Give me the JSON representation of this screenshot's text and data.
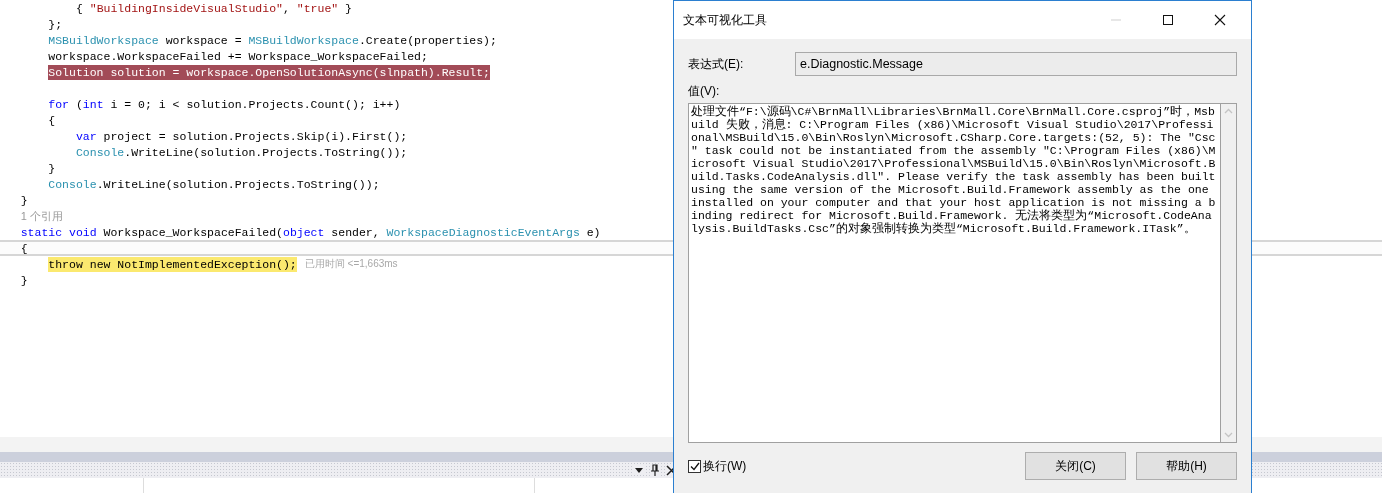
{
  "editor": {
    "lines": [
      {
        "kind": "code",
        "current": false,
        "error": false,
        "paused": false,
        "tokens": [
          {
            "kind": "plain",
            "text": "           { "
          },
          {
            "kind": "string",
            "text": "\"BuildingInsideVisualStudio\""
          },
          {
            "kind": "plain",
            "text": ", "
          },
          {
            "kind": "string",
            "text": "\"true\""
          },
          {
            "kind": "plain",
            "text": " }"
          }
        ]
      },
      {
        "kind": "code",
        "current": false,
        "error": false,
        "paused": false,
        "tokens": [
          {
            "kind": "plain",
            "text": "       };"
          }
        ]
      },
      {
        "kind": "code",
        "current": false,
        "error": false,
        "paused": false,
        "tokens": [
          {
            "kind": "type",
            "text": "       MSBuildWorkspace"
          },
          {
            "kind": "plain",
            "text": " workspace = "
          },
          {
            "kind": "type",
            "text": "MSBuildWorkspace"
          },
          {
            "kind": "plain",
            "text": ".Create(properties);"
          }
        ]
      },
      {
        "kind": "code",
        "current": false,
        "error": false,
        "paused": false,
        "tokens": [
          {
            "kind": "plain",
            "text": "       workspace.WorkspaceFailed += Workspace_WorkspaceFailed;"
          }
        ]
      },
      {
        "kind": "code",
        "current": false,
        "error": true,
        "paused": false,
        "tokens": [
          {
            "kind": "plain",
            "text": "       Solution solution = workspace.OpenSolutionAsync(slnpath).Result;"
          }
        ]
      },
      {
        "kind": "blank"
      },
      {
        "kind": "code",
        "current": false,
        "error": false,
        "paused": false,
        "tokens": [
          {
            "kind": "keyword",
            "text": "       for"
          },
          {
            "kind": "plain",
            "text": " ("
          },
          {
            "kind": "keyword",
            "text": "int"
          },
          {
            "kind": "plain",
            "text": " i = 0; i < solution.Projects.Count(); i++)"
          }
        ]
      },
      {
        "kind": "code",
        "current": false,
        "error": false,
        "paused": false,
        "tokens": [
          {
            "kind": "plain",
            "text": "       {"
          }
        ]
      },
      {
        "kind": "code",
        "current": false,
        "error": false,
        "paused": false,
        "tokens": [
          {
            "kind": "keyword",
            "text": "           var"
          },
          {
            "kind": "plain",
            "text": " project = solution.Projects.Skip(i).First();"
          }
        ]
      },
      {
        "kind": "code",
        "current": false,
        "error": false,
        "paused": false,
        "tokens": [
          {
            "kind": "type",
            "text": "           Console"
          },
          {
            "kind": "plain",
            "text": ".WriteLine(solution.Projects.ToString());"
          }
        ]
      },
      {
        "kind": "code",
        "current": false,
        "error": false,
        "paused": false,
        "tokens": [
          {
            "kind": "plain",
            "text": "       }"
          }
        ]
      },
      {
        "kind": "code",
        "current": false,
        "error": false,
        "paused": false,
        "tokens": [
          {
            "kind": "type",
            "text": "       Console"
          },
          {
            "kind": "plain",
            "text": ".WriteLine(solution.Projects.ToString());"
          }
        ]
      },
      {
        "kind": "code",
        "current": false,
        "error": false,
        "paused": false,
        "tokens": [
          {
            "kind": "plain",
            "text": "   }"
          }
        ]
      },
      {
        "kind": "codelens",
        "text": "   1 个引用"
      },
      {
        "kind": "code",
        "current": false,
        "error": false,
        "paused": false,
        "tokens": [
          {
            "kind": "keyword",
            "text": "   static"
          },
          {
            "kind": "keyword",
            "text": " void"
          },
          {
            "kind": "plain",
            "text": " Workspace_WorkspaceFailed("
          },
          {
            "kind": "keyword",
            "text": "object"
          },
          {
            "kind": "plain",
            "text": " sender, "
          },
          {
            "kind": "type",
            "text": "WorkspaceDiagnosticEventArgs"
          },
          {
            "kind": "plain",
            "text": " e)"
          }
        ]
      },
      {
        "kind": "code",
        "current": true,
        "error": false,
        "paused": false,
        "tokens": [
          {
            "kind": "plain",
            "text": "   {"
          }
        ]
      },
      {
        "kind": "code",
        "current": false,
        "error": false,
        "paused": true,
        "tokens": [
          {
            "kind": "keyword",
            "text": "       throw"
          },
          {
            "kind": "keyword",
            "text": " new"
          },
          {
            "kind": "plain",
            "text": " NotImplementedException();"
          }
        ],
        "perf_tip": "已用时间 <=1,663ms"
      },
      {
        "kind": "code",
        "current": false,
        "error": false,
        "paused": false,
        "tokens": [
          {
            "kind": "plain",
            "text": "   }"
          }
        ]
      }
    ]
  },
  "dialog": {
    "title": "文本可视化工具",
    "window_controls": [
      {
        "kind": "minimize",
        "disabled": true
      },
      {
        "kind": "maximize",
        "disabled": false
      },
      {
        "kind": "close",
        "disabled": false
      }
    ],
    "expression": {
      "label": "表达式(E):",
      "value": "e.Diagnostic.Message"
    },
    "value": {
      "label": "值(V):",
      "text": "处理文件“F:\\源码\\C#\\BrnMall\\Libraries\\BrnMall.Core\\BrnMall.Core.csproj”时，Msbuild 失败，消息: C:\\Program Files (x86)\\Microsoft Visual Studio\\2017\\Professional\\MSBuild\\15.0\\Bin\\Roslyn\\Microsoft.CSharp.Core.targets:(52, 5): The \"Csc\" task could not be instantiated from the assembly \"C:\\Program Files (x86)\\Microsoft Visual Studio\\2017\\Professional\\MSBuild\\15.0\\Bin\\Roslyn\\Microsoft.Build.Tasks.CodeAnalysis.dll\". Please verify the task assembly has been built using the same version of the Microsoft.Build.Framework assembly as the one installed on your computer and that your host application is not missing a binding redirect for Microsoft.Build.Framework. 无法将类型为“Microsoft.CodeAnalysis.BuildTasks.Csc”的对象强制转换为类型“Microsoft.Build.Framework.ITask”。"
    },
    "wrap": {
      "label": "换行(W)",
      "checked": true
    },
    "buttons": [
      "关闭(C)",
      "帮助(H)"
    ]
  }
}
